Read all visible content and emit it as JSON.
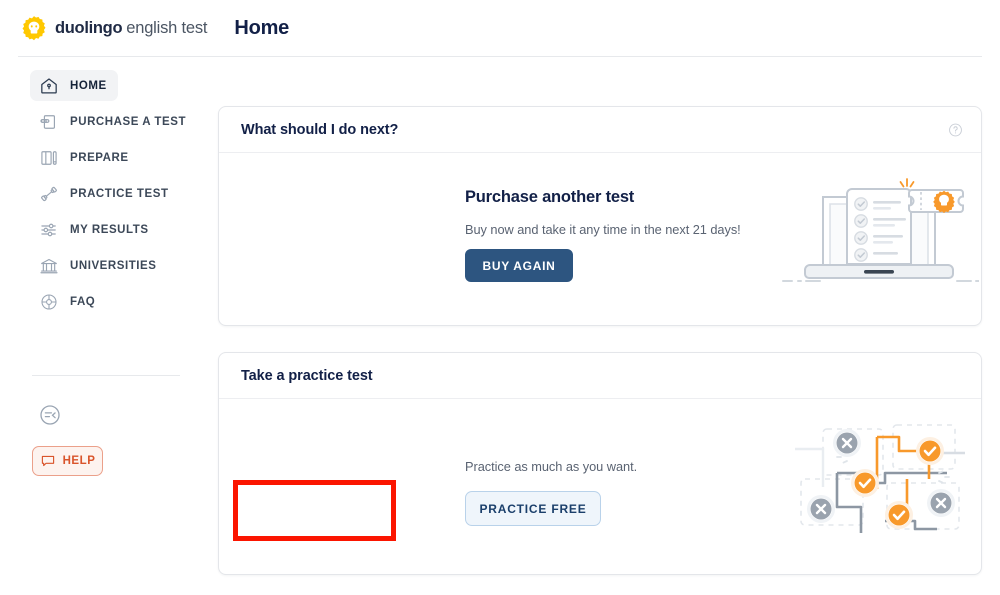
{
  "header": {
    "logo_icon": "duolingo-owl-badge-icon",
    "brand_primary": "duolingo",
    "brand_secondary": "english test",
    "page_title": "Home"
  },
  "sidebar": {
    "items": [
      {
        "label": "HOME",
        "icon": "home-icon",
        "active": true
      },
      {
        "label": "PURCHASE A TEST",
        "icon": "ticket-icon",
        "active": false
      },
      {
        "label": "PREPARE",
        "icon": "book-pen-icon",
        "active": false
      },
      {
        "label": "PRACTICE TEST",
        "icon": "dumbbell-icon",
        "active": false
      },
      {
        "label": "MY RESULTS",
        "icon": "sliders-icon",
        "active": false
      },
      {
        "label": "UNIVERSITIES",
        "icon": "bank-icon",
        "active": false
      },
      {
        "label": "FAQ",
        "icon": "segmented-circle-icon",
        "active": false
      }
    ],
    "collapse_icon": "collapse-sidebar-icon",
    "help": {
      "label": "HELP",
      "icon": "speech-bubble-icon"
    }
  },
  "cards": {
    "next": {
      "header_title": "What should I do next?",
      "help_icon": "question-mark-circle-icon",
      "heading": "Purchase another test",
      "description": "Buy now and take it any time in the next 21 days!",
      "button_label": "BUY AGAIN",
      "illustration": "laptop-checklist-ticket-illustration"
    },
    "practice": {
      "header_title": "Take a practice test",
      "description": "Practice as much as you want.",
      "button_label": "PRACTICE FREE",
      "illustration": "maze-check-cross-illustration"
    }
  },
  "annotation": {
    "target": "practice-free-button",
    "color": "#fb1500"
  },
  "colors": {
    "brand_yellow": "#ffc800",
    "navy": "#122047",
    "buy_button": "#2d5580",
    "practice_button_bg": "#eff5fb",
    "practice_button_border": "#b9d2ea",
    "help_orange": "#d9542b",
    "help_bg": "#fdf3ef",
    "illustration_orange": "#f8992b",
    "illustration_gray": "#9aa3ae"
  }
}
